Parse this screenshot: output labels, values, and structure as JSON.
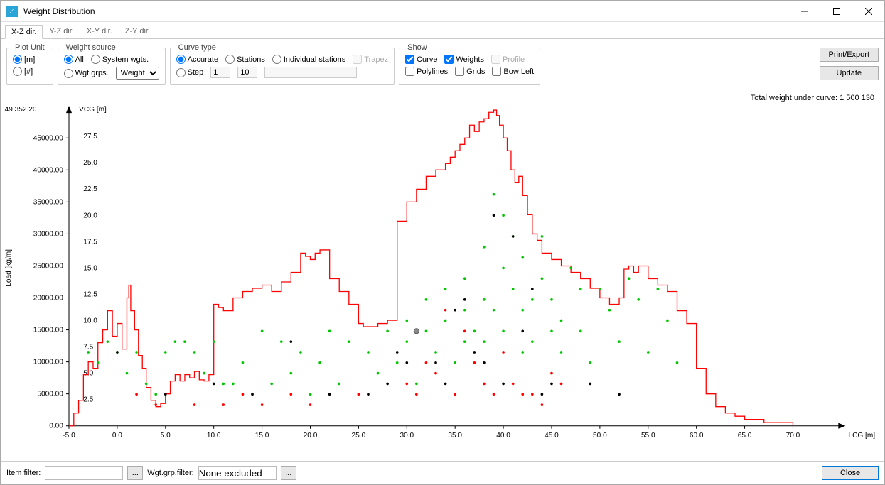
{
  "window": {
    "title": "Weight Distribution"
  },
  "tabs": [
    "X-Z dir.",
    "Y-Z dir.",
    "X-Y dir.",
    "Z-Y dir."
  ],
  "active_tab": 0,
  "plot_unit": {
    "legend": "Plot Unit",
    "m": "[m]",
    "hash": "[#]"
  },
  "weight_source": {
    "legend": "Weight source",
    "all": "All",
    "system": "System wgts.",
    "wgtgrps": "Wgt.grps.",
    "select_options": [
      "Weight"
    ]
  },
  "curve_type": {
    "legend": "Curve type",
    "accurate": "Accurate",
    "stations": "Stations",
    "individual": "Individual stations",
    "trapez": "Trapez",
    "step": "Step",
    "step_a": "1",
    "step_b": "10",
    "step_c": ""
  },
  "show": {
    "legend": "Show",
    "curve": "Curve",
    "weights": "Weights",
    "profile": "Profile",
    "polylines": "Polylines",
    "grids": "Grids",
    "bowleft": "Bow Left"
  },
  "buttons": {
    "print": "Print/Export",
    "update": "Update",
    "close": "Close"
  },
  "footer": {
    "item_filter": "Item filter:",
    "wgt_filter": "Wgt.grp.filter:",
    "wgt_filter_val": "None excluded"
  },
  "chart": {
    "total_label": "Total weight under curve: 1 500 130",
    "y_left_label": "Load [kg/m]",
    "y_top_value": "49 352.20",
    "y_right_label": "VCG [m]",
    "x_label": "LCG [m]"
  },
  "chart_data": {
    "type": "line",
    "xlabel": "LCG [m]",
    "ylabel_left": "Load [kg/m]",
    "ylabel_right": "VCG [m]",
    "xlim": [
      -5,
      75
    ],
    "ylim_left": [
      0,
      49352.2
    ],
    "ylim_right": [
      0,
      30
    ],
    "y_left_ticks": [
      0,
      5000,
      10000,
      15000,
      20000,
      25000,
      30000,
      35000,
      40000,
      45000
    ],
    "y_right_ticks": [
      2.5,
      5.0,
      7.5,
      10.0,
      12.5,
      15.0,
      17.5,
      20.0,
      22.5,
      25.0,
      27.5
    ],
    "x_ticks": [
      -5,
      0,
      5,
      10,
      15,
      20,
      25,
      30,
      35,
      40,
      45,
      50,
      55,
      60,
      65,
      70
    ],
    "series": [
      {
        "name": "Load curve",
        "color": "#ff0000",
        "x": [
          -5,
          -4.5,
          -4,
          -3.5,
          -3,
          -2.5,
          -2,
          -1.5,
          -1,
          -0.5,
          0,
          0.5,
          1,
          1.2,
          1.4,
          1.8,
          2.2,
          2.6,
          3,
          3.5,
          4,
          4.5,
          5,
          5.5,
          6,
          6.5,
          7,
          7.5,
          8,
          8.5,
          9,
          9.5,
          10,
          10.5,
          11,
          12,
          13,
          14,
          15,
          16,
          17,
          18,
          19,
          19.5,
          20,
          20.5,
          21,
          22,
          23,
          24,
          25,
          25.5,
          26,
          27,
          28,
          29,
          30,
          31,
          32,
          33,
          34,
          34.5,
          35,
          35.5,
          36,
          36.5,
          37,
          37.5,
          38,
          38.5,
          39,
          39.3,
          39.6,
          40,
          40.4,
          40.8,
          41.2,
          41.6,
          42,
          42.5,
          43,
          43.5,
          44,
          45,
          46,
          47,
          48,
          49,
          50,
          51,
          52,
          52.5,
          53,
          53.5,
          54,
          55,
          56,
          57,
          58,
          59,
          60,
          61,
          62,
          63,
          64,
          65,
          67,
          70
        ],
        "y": [
          0,
          2000,
          4000,
          8000,
          10000,
          9000,
          13000,
          15000,
          18000,
          14000,
          16000,
          12000,
          20000,
          22000,
          18000,
          15000,
          11000,
          9000,
          6000,
          4000,
          3000,
          3500,
          5000,
          7000,
          8000,
          7000,
          8000,
          7500,
          8500,
          7200,
          7000,
          8000,
          19000,
          18500,
          18000,
          20000,
          21000,
          21500,
          22000,
          21000,
          22500,
          24000,
          27000,
          26500,
          26000,
          27000,
          27500,
          23000,
          21000,
          19000,
          16000,
          15500,
          15500,
          16000,
          16500,
          32000,
          35000,
          37000,
          39000,
          40000,
          41000,
          42000,
          43000,
          44000,
          45000,
          47000,
          46000,
          47500,
          48000,
          49000,
          49352,
          48500,
          47000,
          45000,
          43000,
          40000,
          38000,
          39000,
          36000,
          33000,
          30000,
          29000,
          27000,
          26000,
          25000,
          24000,
          23000,
          21500,
          20000,
          19000,
          20000,
          24500,
          25000,
          24000,
          25000,
          23000,
          22000,
          21000,
          18000,
          16000,
          9000,
          5000,
          3000,
          2000,
          1500,
          1000,
          500,
          200,
          0
        ]
      }
    ],
    "scatter": {
      "green": [
        [
          -3,
          7
        ],
        [
          -2,
          6
        ],
        [
          -1,
          8
        ],
        [
          0,
          7
        ],
        [
          1,
          5
        ],
        [
          2,
          7
        ],
        [
          3,
          4
        ],
        [
          4,
          3
        ],
        [
          5,
          7
        ],
        [
          6,
          8
        ],
        [
          7,
          8
        ],
        [
          8,
          7
        ],
        [
          9,
          5
        ],
        [
          10,
          8
        ],
        [
          11,
          4
        ],
        [
          12,
          4
        ],
        [
          13,
          6
        ],
        [
          14,
          3
        ],
        [
          15,
          9
        ],
        [
          16,
          4
        ],
        [
          17,
          8
        ],
        [
          18,
          5
        ],
        [
          19,
          7
        ],
        [
          20,
          3
        ],
        [
          21,
          6
        ],
        [
          22,
          9
        ],
        [
          23,
          4
        ],
        [
          24,
          8
        ],
        [
          25,
          3
        ],
        [
          26,
          7
        ],
        [
          27,
          5
        ],
        [
          28,
          9
        ],
        [
          29,
          6
        ],
        [
          30,
          8
        ],
        [
          31,
          4
        ],
        [
          32,
          12
        ],
        [
          33,
          7
        ],
        [
          34,
          10
        ],
        [
          35,
          6
        ],
        [
          36,
          14
        ],
        [
          37,
          9
        ],
        [
          38,
          17
        ],
        [
          39,
          11
        ],
        [
          40,
          20
        ],
        [
          41,
          13
        ],
        [
          42,
          16
        ],
        [
          43,
          8
        ],
        [
          44,
          18
        ],
        [
          45,
          12
        ],
        [
          46,
          7
        ],
        [
          47,
          15
        ],
        [
          48,
          9
        ],
        [
          49,
          6
        ],
        [
          50,
          13
        ],
        [
          51,
          11
        ],
        [
          52,
          8
        ],
        [
          53,
          14
        ],
        [
          54,
          12
        ],
        [
          55,
          7
        ],
        [
          56,
          13
        ],
        [
          57,
          10
        ],
        [
          58,
          6
        ],
        [
          30,
          10
        ],
        [
          32,
          9
        ],
        [
          34,
          13
        ],
        [
          36,
          11
        ],
        [
          38,
          8
        ],
        [
          40,
          15
        ],
        [
          42,
          7
        ],
        [
          44,
          14
        ],
        [
          46,
          10
        ],
        [
          48,
          13
        ],
        [
          39,
          22
        ],
        [
          41,
          18
        ],
        [
          43,
          12
        ],
        [
          45,
          9
        ],
        [
          36,
          8
        ],
        [
          38,
          12
        ],
        [
          40,
          9
        ],
        [
          42,
          11
        ]
      ],
      "red": [
        [
          2,
          3
        ],
        [
          4,
          2
        ],
        [
          8,
          2
        ],
        [
          11,
          2
        ],
        [
          13,
          3
        ],
        [
          15,
          2
        ],
        [
          18,
          3
        ],
        [
          20,
          2
        ],
        [
          25,
          3
        ],
        [
          30,
          4
        ],
        [
          32,
          6
        ],
        [
          34,
          11
        ],
        [
          36,
          9
        ],
        [
          38,
          4
        ],
        [
          40,
          7
        ],
        [
          42,
          3
        ],
        [
          44,
          2
        ],
        [
          46,
          4
        ],
        [
          31,
          3
        ],
        [
          33,
          5
        ],
        [
          35,
          3
        ],
        [
          37,
          6
        ],
        [
          39,
          3
        ],
        [
          41,
          4
        ],
        [
          43,
          3
        ],
        [
          45,
          5
        ]
      ],
      "black": [
        [
          0,
          7
        ],
        [
          5,
          3
        ],
        [
          10,
          4
        ],
        [
          14,
          3
        ],
        [
          18,
          8
        ],
        [
          22,
          3
        ],
        [
          26,
          3
        ],
        [
          29,
          7
        ],
        [
          31,
          9
        ],
        [
          33,
          6
        ],
        [
          35,
          11
        ],
        [
          37,
          7
        ],
        [
          39,
          20
        ],
        [
          41,
          18
        ],
        [
          43,
          13
        ],
        [
          45,
          4
        ],
        [
          49,
          4
        ],
        [
          52,
          3
        ],
        [
          28,
          4
        ],
        [
          30,
          6
        ],
        [
          34,
          4
        ],
        [
          36,
          12
        ],
        [
          38,
          6
        ],
        [
          40,
          4
        ],
        [
          42,
          9
        ],
        [
          44,
          3
        ]
      ]
    }
  }
}
